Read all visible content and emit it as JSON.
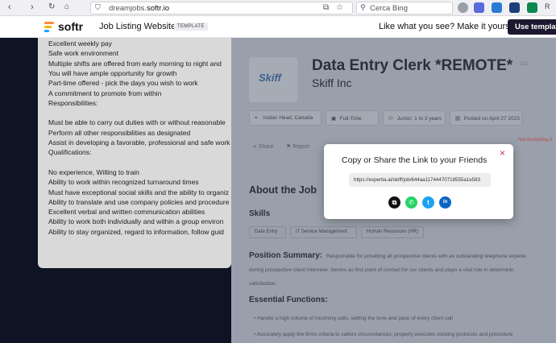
{
  "browser": {
    "back": "‹",
    "forward": "›",
    "url_host": "dreamjobs.",
    "url_domain": "softr.io",
    "search_placeholder": "Cerca Bing",
    "user_initial": "R"
  },
  "banner": {
    "brand": "softr",
    "site_title": "Job Listing Website",
    "badge": "TEMPLATE",
    "promo": "Like what you see? Make it yours",
    "cta": "Use template",
    "logo_colors": [
      "#ff8a3d",
      "#f5b400",
      "#1aa3ff"
    ]
  },
  "left_card": {
    "lines": [
      "Excellent weekly pay",
      "Safe work environment",
      "Multiple shifts are offered from early morning to night and",
      "You will have ample opportunity for growth",
      "Part-time offered - pick the days you wish to work",
      "A commitment to promote from within",
      "Responsibilities:",
      "",
      "Must be able to carry out duties with or without reasonable",
      "Perform all other responsibilities as designated",
      "Assist in developing a favorable, professional and safe work",
      "Qualifications:",
      "",
      "No experience, Willing to train",
      "Ability to work within recognized turnaround times",
      "Must have exceptional social skills and the ability to organiz",
      "Ability to translate and use company policies and procedure",
      "Excellent verbal and written communication abilities",
      "Ability to work both individually and within a group environ",
      "Ability to stay organized, regard to information, follow guid"
    ]
  },
  "job": {
    "logo_text": "Skiff",
    "title": "Data Entry Clerk *REMOTE*",
    "company": "Skiff Inc",
    "views": "112",
    "tags": [
      {
        "icon": "location-icon",
        "glyph": "⌖",
        "label": "Indian Head, Canada"
      },
      {
        "icon": "briefcase-icon",
        "glyph": "▣",
        "label": "Full-Time"
      },
      {
        "icon": "user-icon",
        "glyph": "⚇",
        "label": "Junior: 1 to 3 years"
      },
      {
        "icon": "calendar-icon",
        "glyph": "▤",
        "label": "Posted on April 27 2023"
      }
    ],
    "share_label": "Share",
    "report_label": "Report",
    "status": "Not Accepting A",
    "about_heading": "About the Job",
    "skills_heading": "Skills",
    "skills": [
      "Data Entry",
      "IT Service Management",
      "Human Resources (HR)"
    ],
    "position_heading": "Position Summary:",
    "position_lines": [
      "Responsible for providing all prospective clients with as outstanding telephone experie",
      "during prospective client interview. Serves as first point of contact for our clients and plays a vital role in determinin",
      "satisfaction."
    ],
    "essential_heading": "Essential Functions:",
    "essential_items": [
      "Handle a high volume of incoming calls, setting the tone and pace of every client call",
      "Accurately apply the firms criteria to callers circumstances; properly executes existing protocols and procedure"
    ]
  },
  "modal": {
    "title": "Copy or Share the Link to your Friends",
    "link": "https://expertia.ai/skiff/job/644aa11744470718555a1e583",
    "close_glyph": "×",
    "share_buttons": [
      {
        "name": "copy-link-icon",
        "glyph": "⧉",
        "color": "#111111"
      },
      {
        "name": "whatsapp-icon",
        "glyph": "✆",
        "color": "#25d366"
      },
      {
        "name": "twitter-icon",
        "glyph": "t",
        "color": "#1da1f2"
      },
      {
        "name": "linkedin-icon",
        "glyph": "in",
        "color": "#0a66c2"
      }
    ]
  }
}
